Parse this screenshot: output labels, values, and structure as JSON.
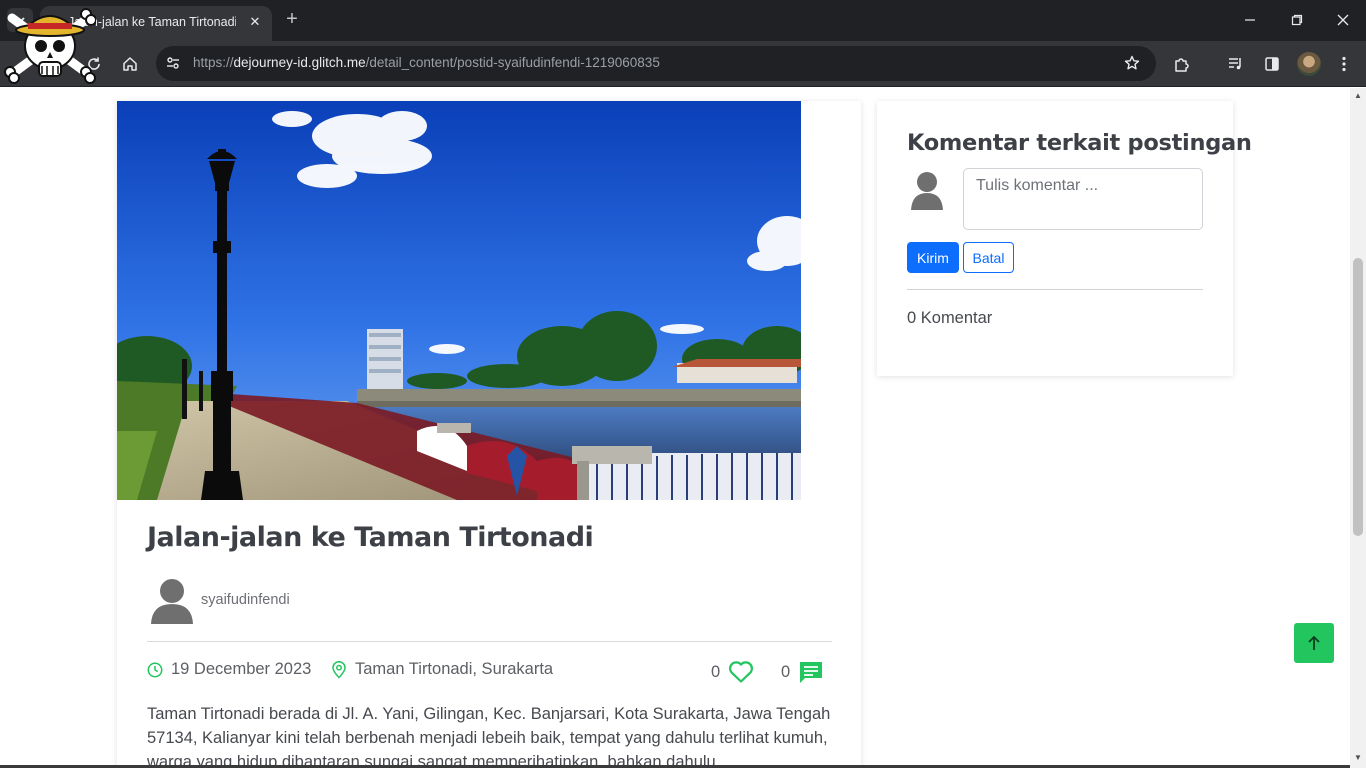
{
  "browser": {
    "tab_title": "Jalan-jalan ke Taman Tirtonadi",
    "url_scheme": "https://",
    "url_host": "dejourney-id.glitch.me",
    "url_path": "/detail_content/postid-syaifudinfendi-1219060835"
  },
  "post": {
    "title": "Jalan-jalan ke Taman Tirtonadi",
    "author": "syaifudinfendi",
    "date": "19 December 2023",
    "location": "Taman Tirtonadi, Surakarta",
    "likes": "0",
    "comments": "0",
    "body": "Taman Tirtonadi berada di Jl. A. Yani, Gilingan, Kec. Banjarsari, Kota Surakarta, Jawa Tengah 57134, Kalianyar kini telah berbenah menjadi lebeih baik, tempat yang dahulu terlihat kumuh, warga yang hidup dibantaran sungai sangat memperihatinkan, bahkan dahulu"
  },
  "comments_panel": {
    "title": "Komentar terkait postingan",
    "placeholder": "Tulis komentar ...",
    "submit_label": "Kirim",
    "cancel_label": "Batal",
    "count_text": "0 Komentar"
  },
  "colors": {
    "accent_green": "#22c55e",
    "primary_blue": "#0d6efd"
  },
  "icons": {
    "date": "clock-icon",
    "location": "map-pin-icon",
    "like": "heart-icon",
    "comment": "chat-icon",
    "back_to_top": "arrow-up-icon"
  }
}
